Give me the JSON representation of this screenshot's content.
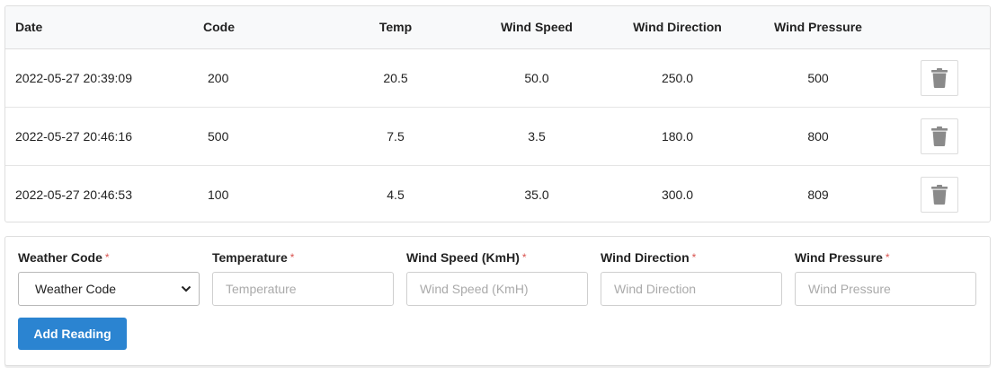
{
  "table": {
    "headers": {
      "date": "Date",
      "code": "Code",
      "temp": "Temp",
      "wind_speed": "Wind Speed",
      "wind_direction": "Wind Direction",
      "wind_pressure": "Wind Pressure"
    },
    "rows": [
      {
        "date": "2022-05-27 20:39:09",
        "code": "200",
        "temp": "20.5",
        "wind_speed": "50.0",
        "wind_direction": "250.0",
        "wind_pressure": "500",
        "delete_icon": "trash-icon"
      },
      {
        "date": "2022-05-27 20:46:16",
        "code": "500",
        "temp": "7.5",
        "wind_speed": "3.5",
        "wind_direction": "180.0",
        "wind_pressure": "800",
        "delete_icon": "trash-icon"
      },
      {
        "date": "2022-05-27 20:46:53",
        "code": "100",
        "temp": "4.5",
        "wind_speed": "35.0",
        "wind_direction": "300.0",
        "wind_pressure": "809",
        "delete_icon": "trash-icon"
      }
    ]
  },
  "form": {
    "required_marker": "*",
    "weather_code": {
      "label": "Weather Code",
      "selected": "Weather Code"
    },
    "temperature": {
      "label": "Temperature",
      "placeholder": "Temperature"
    },
    "wind_speed": {
      "label": "Wind Speed (KmH)",
      "placeholder": "Wind Speed (KmH)"
    },
    "wind_direction": {
      "label": "Wind Direction",
      "placeholder": "Wind Direction"
    },
    "wind_pressure": {
      "label": "Wind Pressure",
      "placeholder": "Wind Pressure"
    },
    "submit_label": "Add Reading"
  },
  "colors": {
    "primary": "#2b84d1",
    "required": "#d9534f",
    "icon_gray": "#8a8a8a"
  }
}
